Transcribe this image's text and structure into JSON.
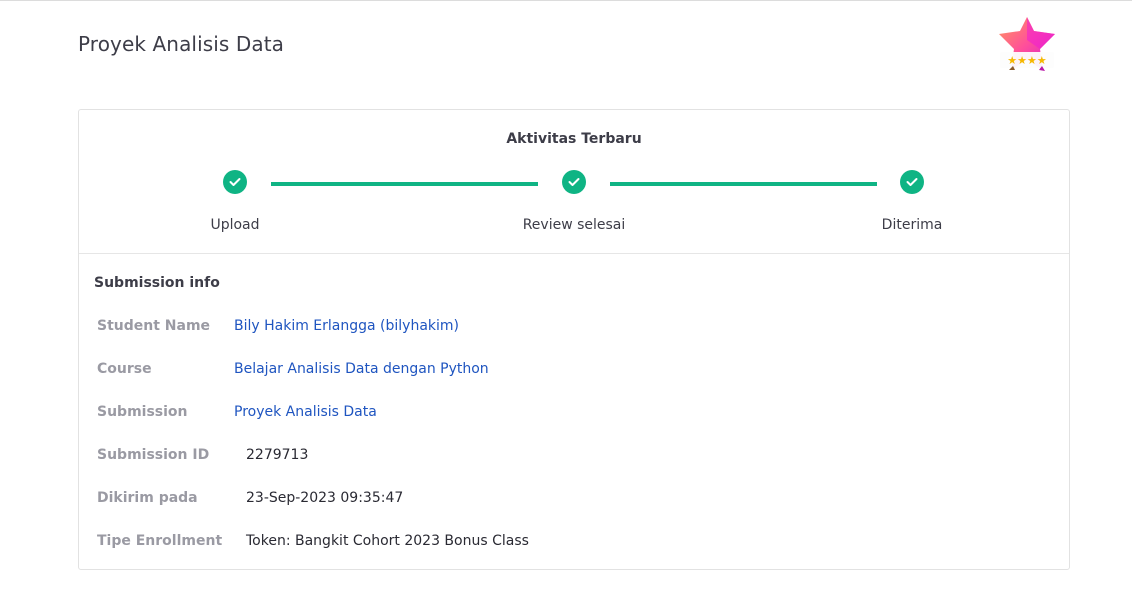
{
  "page": {
    "title": "Proyek Analisis Data"
  },
  "activity": {
    "title": "Aktivitas Terbaru",
    "steps": [
      {
        "label": "Upload",
        "status": "done"
      },
      {
        "label": "Review selesai",
        "status": "done"
      },
      {
        "label": "Diterima",
        "status": "done"
      }
    ],
    "accent_color": "#0fb484"
  },
  "submission_info": {
    "title": "Submission info",
    "rows": [
      {
        "label": "Student Name",
        "value": "Bily Hakim Erlangga (bilyhakim)",
        "link": true
      },
      {
        "label": "Course",
        "value": "Belajar Analisis Data dengan Python",
        "link": true
      },
      {
        "label": "Submission",
        "value": "Proyek Analisis Data",
        "link": true
      },
      {
        "label": "Submission ID",
        "value": "2279713",
        "link": false
      },
      {
        "label": "Dikirim pada",
        "value": "23-Sep-2023 09:35:47",
        "link": false
      },
      {
        "label": "Tipe Enrollment",
        "value": "Token: Bangkit Cohort 2023 Bonus Class",
        "link": false
      }
    ]
  },
  "badge": {
    "icon": "star-rating-badge-icon",
    "stars": 4
  }
}
